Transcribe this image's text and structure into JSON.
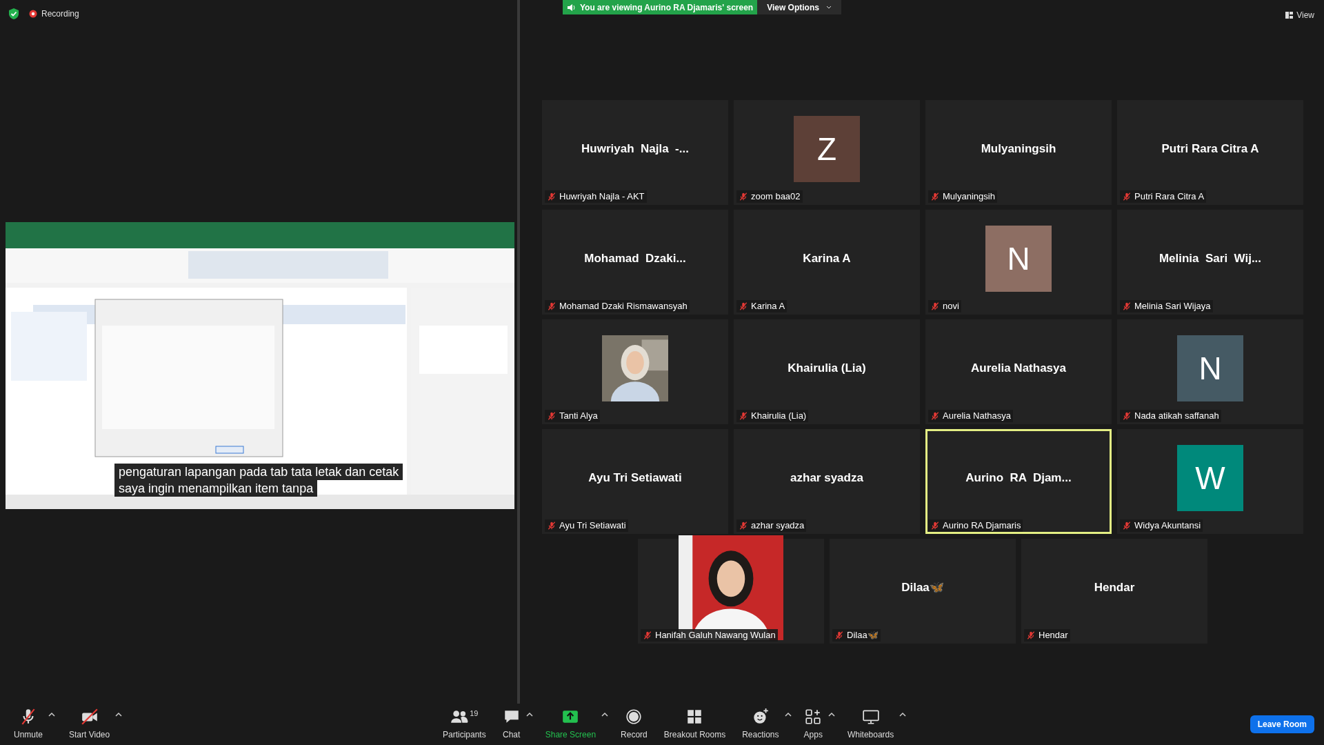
{
  "top_bar": {
    "recording": "Recording",
    "viewing_banner": "You are viewing Aurino RA Djamaris' screen",
    "view_options": "View Options",
    "view": "View"
  },
  "shared_screen": {
    "kind": "picture",
    "captions": [
      "pengaturan lapangan pada tab tata letak dan cetak",
      "saya ingin menampilkan item tanpa"
    ]
  },
  "participants": [
    {
      "kind": "name",
      "display": "Huwriyah  Najla  -...",
      "label": "Huwriyah Najla - AKT",
      "muted": true,
      "speaking": false
    },
    {
      "kind": "initial",
      "display": "Z",
      "color": "#5d4037",
      "label": "zoom baa02",
      "muted": true,
      "speaking": false
    },
    {
      "kind": "name",
      "display": "Mulyaningsih",
      "label": "Mulyaningsih",
      "muted": true,
      "speaking": false
    },
    {
      "kind": "name",
      "display": "Putri Rara Citra A",
      "label": "Putri Rara Citra A",
      "muted": true,
      "speaking": false
    },
    {
      "kind": "name",
      "display": "Mohamad  Dzaki...",
      "label": "Mohamad Dzaki Rismawansyah",
      "muted": true,
      "speaking": false
    },
    {
      "kind": "name",
      "display": "Karina A",
      "label": "Karina A",
      "muted": true,
      "speaking": false
    },
    {
      "kind": "initial",
      "display": "N",
      "color": "#8d6e63",
      "label": "novi",
      "muted": true,
      "speaking": false
    },
    {
      "kind": "name",
      "display": "Melinia  Sari  Wij...",
      "label": "Melinia Sari Wijaya",
      "muted": true,
      "speaking": false
    },
    {
      "kind": "picture",
      "label": "Tanti Alya",
      "muted": true,
      "speaking": false
    },
    {
      "kind": "name",
      "display": "Khairulia (Lia)",
      "label": "Khairulia (Lia)",
      "muted": true,
      "speaking": false
    },
    {
      "kind": "name",
      "display": "Aurelia Nathasya",
      "label": "Aurelia Nathasya",
      "muted": true,
      "speaking": false
    },
    {
      "kind": "initial",
      "display": "N",
      "color": "#455a64",
      "label": "Nada atikah saffanah",
      "muted": true,
      "speaking": false
    },
    {
      "kind": "name",
      "display": "Ayu Tri Setiawati",
      "label": "Ayu Tri Setiawati",
      "muted": true,
      "speaking": false
    },
    {
      "kind": "name",
      "display": "azhar syadza",
      "label": "azhar syadza",
      "muted": true,
      "speaking": false
    },
    {
      "kind": "name",
      "display": "Aurino  RA  Djam...",
      "label": "Aurino RA Djamaris",
      "muted": true,
      "speaking": true
    },
    {
      "kind": "initial",
      "display": "W",
      "color": "#00897b",
      "label": "Widya Akuntansi",
      "muted": true,
      "speaking": false
    },
    {
      "kind": "picture",
      "label": "Hanifah Galuh Nawang Wulan",
      "muted": true,
      "speaking": false
    },
    {
      "kind": "name",
      "display": "Dilaa🦋",
      "label": "Dilaa🦋",
      "muted": true,
      "speaking": false
    },
    {
      "kind": "name",
      "display": "Hendar",
      "label": "Hendar",
      "muted": true,
      "speaking": false
    }
  ],
  "toolbar": {
    "left": [
      {
        "kind": "mic_off",
        "label": "Unmute",
        "caret": true
      },
      {
        "kind": "video_off",
        "label": "Start Video",
        "caret": true
      }
    ],
    "center": [
      {
        "kind": "participants",
        "label": "Participants",
        "count": "19",
        "caret": false
      },
      {
        "kind": "chat",
        "label": "Chat",
        "caret": true
      },
      {
        "kind": "share",
        "label": "Share Screen",
        "caret": true
      },
      {
        "kind": "record",
        "label": "Record",
        "caret": false
      },
      {
        "kind": "breakout",
        "label": "Breakout Rooms",
        "caret": false
      },
      {
        "kind": "reactions",
        "label": "Reactions",
        "caret": true
      },
      {
        "kind": "apps",
        "label": "Apps",
        "caret": true
      },
      {
        "kind": "whiteboards",
        "label": "Whiteboards",
        "caret": true
      }
    ],
    "leave": "Leave Room"
  }
}
